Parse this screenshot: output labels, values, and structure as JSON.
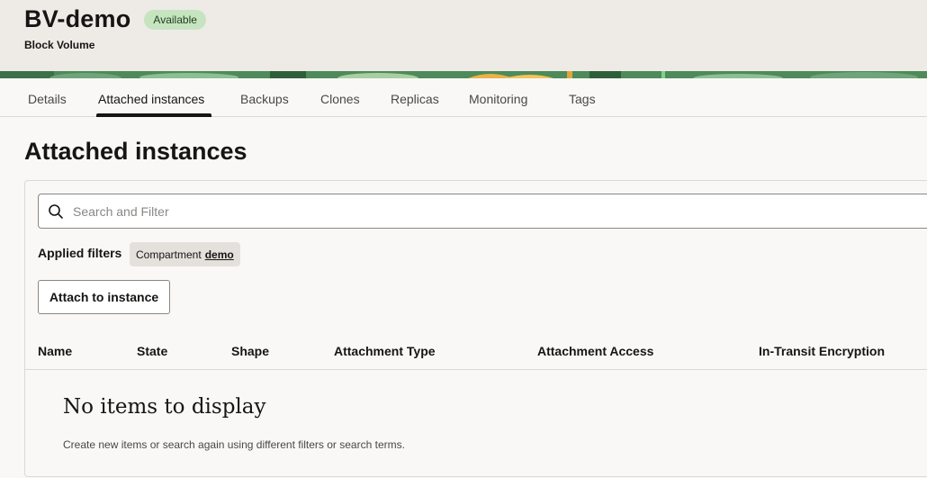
{
  "header": {
    "title": "BV-demo",
    "status": "Available",
    "subtitle": "Block Volume"
  },
  "tabs": [
    {
      "label": "Details"
    },
    {
      "label": "Attached instances",
      "active": true
    },
    {
      "label": "Backups"
    },
    {
      "label": "Clones"
    },
    {
      "label": "Replicas"
    },
    {
      "label": "Monitoring"
    },
    {
      "label": "Tags"
    }
  ],
  "section": {
    "title": "Attached instances"
  },
  "search": {
    "placeholder": "Search and Filter",
    "icon": "search-icon"
  },
  "filters": {
    "label": "Applied filters",
    "chip_key": "Compartment",
    "chip_value": "demo"
  },
  "actions": {
    "attach_label": "Attach to instance"
  },
  "table": {
    "columns": [
      "Name",
      "State",
      "Shape",
      "Attachment Type",
      "Attachment Access",
      "In-Transit Encryption"
    ]
  },
  "empty": {
    "title": "No items to display",
    "description": "Create new items or search again using different filters or search terms."
  },
  "colors": {
    "status_badge": "#c5e4bf",
    "header_bg": "#eeebe7",
    "banner_green": "#4e8a5a"
  }
}
